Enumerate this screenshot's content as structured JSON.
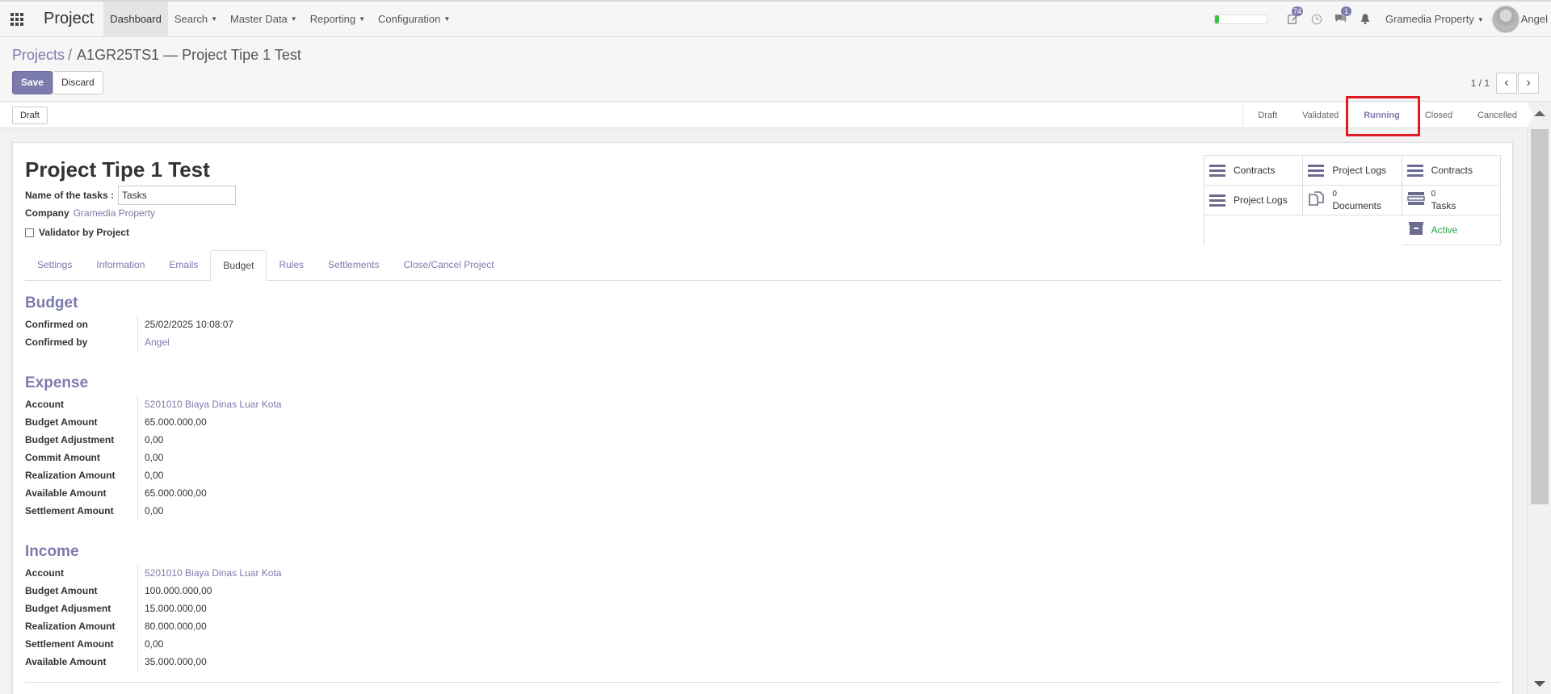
{
  "navbar": {
    "app_name": "Project",
    "menu": [
      {
        "label": "Dashboard",
        "caret": false
      },
      {
        "label": "Search",
        "caret": true
      },
      {
        "label": "Master Data",
        "caret": true
      },
      {
        "label": "Reporting",
        "caret": true
      },
      {
        "label": "Configuration",
        "caret": true
      }
    ],
    "progress_fraction": 0.08,
    "activity_badge": "74",
    "messages_badge": "1",
    "company": "Gramedia Property",
    "user": "Angel",
    "icons": [
      "apps-grid-icon",
      "activity-icon",
      "clock-icon",
      "chat-icon",
      "bell-icon",
      "avatar"
    ]
  },
  "breadcrumb": {
    "parent": "Projects",
    "separator": "/",
    "current": "A1GR25TS1 — Project Tipe 1 Test"
  },
  "actions": {
    "save": "Save",
    "discard": "Discard"
  },
  "pager": {
    "value": "1 / 1",
    "prev": "‹",
    "next": "›"
  },
  "statusbar": {
    "draft_button": "Draft",
    "stages": [
      "Draft",
      "Validated",
      "Running",
      "Closed",
      "Cancelled"
    ],
    "current_stage": "Running"
  },
  "form": {
    "title": "Project Tipe 1 Test",
    "tasks_label": "Name of the tasks :",
    "tasks_value": "Tasks",
    "company_label": "Company",
    "company_value": "Gramedia Property",
    "validator_label": "Validator by Project",
    "validator_checked": false
  },
  "smart_buttons": [
    {
      "icon": "list-icon",
      "label": "Contracts"
    },
    {
      "icon": "list-icon",
      "label": "Project Logs"
    },
    {
      "icon": "list-icon",
      "label": "Contracts"
    },
    {
      "icon": "list-icon",
      "label": "Project Logs"
    },
    {
      "icon": "documents-icon",
      "count": "0",
      "label": "Documents"
    },
    {
      "icon": "tasks-icon",
      "count": "0",
      "label": "Tasks"
    },
    {
      "icon": "archive-icon",
      "label": "Active"
    }
  ],
  "tabs": [
    "Settings",
    "Information",
    "Emails",
    "Budget",
    "Rules",
    "Settlements",
    "Close/Cancel Project"
  ],
  "active_tab": "Budget",
  "budget": {
    "title": "Budget",
    "rows": [
      {
        "label": "Confirmed on",
        "value": "25/02/2025 10:08:07",
        "link": false
      },
      {
        "label": "Confirmed by",
        "value": "Angel",
        "link": true
      }
    ]
  },
  "expense": {
    "title": "Expense",
    "rows": [
      {
        "label": "Account",
        "value": "5201010 Biaya Dinas Luar Kota",
        "link": true
      },
      {
        "label": "Budget Amount",
        "value": "65.000.000,00",
        "link": false
      },
      {
        "label": "Budget Adjustment",
        "value": "0,00",
        "link": false
      },
      {
        "label": "Commit Amount",
        "value": "0,00",
        "link": false
      },
      {
        "label": "Realization Amount",
        "value": "0,00",
        "link": false
      },
      {
        "label": "Available Amount",
        "value": "65.000.000,00",
        "link": false
      },
      {
        "label": "Settlement Amount",
        "value": "0,00",
        "link": false
      }
    ]
  },
  "income": {
    "title": "Income",
    "rows": [
      {
        "label": "Account",
        "value": "5201010 Biaya Dinas Luar Kota",
        "link": true
      },
      {
        "label": "Budget Amount",
        "value": "100.000.000,00",
        "link": false
      },
      {
        "label": "Budget Adjusment",
        "value": "15.000.000,00",
        "link": false
      },
      {
        "label": "Realization Amount",
        "value": "80.000.000,00",
        "link": false
      },
      {
        "label": "Settlement Amount",
        "value": "0,00",
        "link": false
      },
      {
        "label": "Available Amount",
        "value": "35.000.000,00",
        "link": false
      }
    ]
  },
  "colors": {
    "brand": "#7c7bad",
    "highlight": "#e01b24",
    "active": "#28a745"
  }
}
